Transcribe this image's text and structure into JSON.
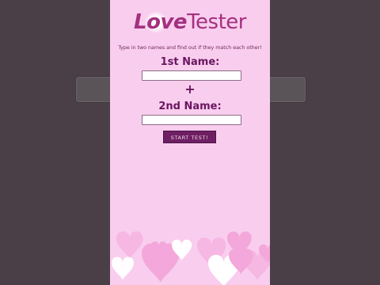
{
  "logo": {
    "part1": "Love",
    "part2": "Tester"
  },
  "tagline": "Type in two names and find out if they match each other!",
  "form": {
    "first_label": "1st Name:",
    "plus": "+",
    "second_label": "2nd Name:",
    "first_value": "",
    "second_value": "",
    "button_label": "START TEST!"
  },
  "colors": {
    "background": "#f9cdee",
    "accent": "#a3317f",
    "button": "#6e1f63",
    "letterbox": "#4b3f47"
  },
  "icons": [
    "heart-icon",
    "plus-icon",
    "hearts-decoration"
  ]
}
